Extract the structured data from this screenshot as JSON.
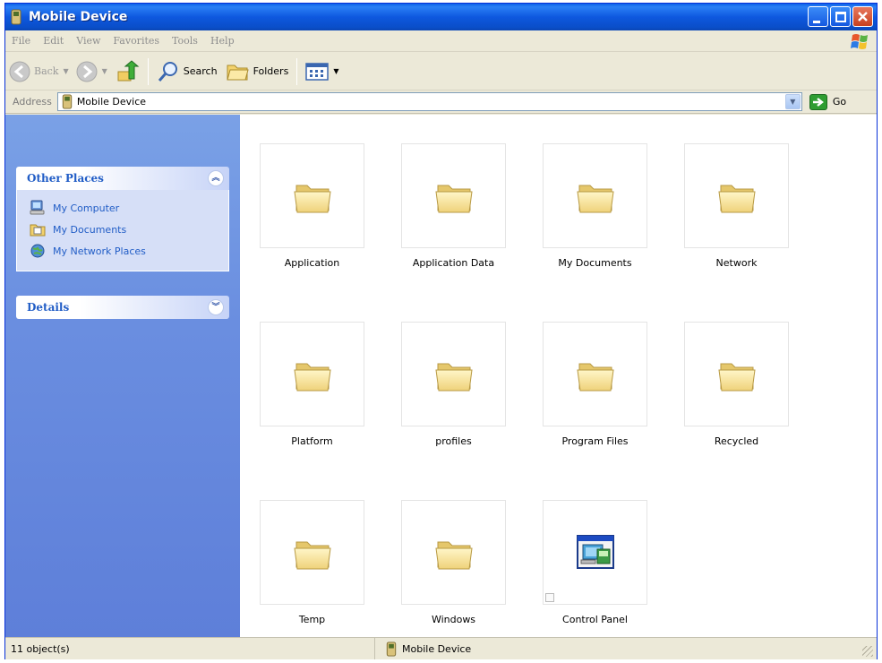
{
  "window": {
    "title": "Mobile Device"
  },
  "menu": [
    "File",
    "Edit",
    "View",
    "Favorites",
    "Tools",
    "Help"
  ],
  "toolbar": {
    "back_label": "Back",
    "search_label": "Search",
    "folders_label": "Folders"
  },
  "address": {
    "label": "Address",
    "value": "Mobile Device",
    "go_label": "Go"
  },
  "taskpane": {
    "other_places": {
      "title": "Other Places",
      "items": [
        {
          "label": "My Computer",
          "icon": "my-computer-icon"
        },
        {
          "label": "My Documents",
          "icon": "my-documents-icon"
        },
        {
          "label": "My Network Places",
          "icon": "network-places-icon"
        }
      ]
    },
    "details": {
      "title": "Details"
    }
  },
  "items": [
    {
      "label": "Application",
      "icon": "folder-icon"
    },
    {
      "label": "Application Data",
      "icon": "folder-icon"
    },
    {
      "label": "My Documents",
      "icon": "folder-icon"
    },
    {
      "label": "Network",
      "icon": "folder-icon"
    },
    {
      "label": "Platform",
      "icon": "folder-icon"
    },
    {
      "label": "profiles",
      "icon": "folder-icon"
    },
    {
      "label": "Program Files",
      "icon": "folder-icon"
    },
    {
      "label": "Recycled",
      "icon": "folder-icon"
    },
    {
      "label": "Temp",
      "icon": "folder-icon"
    },
    {
      "label": "Windows",
      "icon": "folder-icon"
    },
    {
      "label": "Control Panel",
      "icon": "control-panel-icon"
    }
  ],
  "status": {
    "count": "11 object(s)",
    "location": "Mobile Device"
  },
  "colors": {
    "titlebar": "#0a4ec9",
    "taskpane": "#6a8ee0",
    "panel_title": "#215dc6",
    "folder": "#f5df86"
  }
}
